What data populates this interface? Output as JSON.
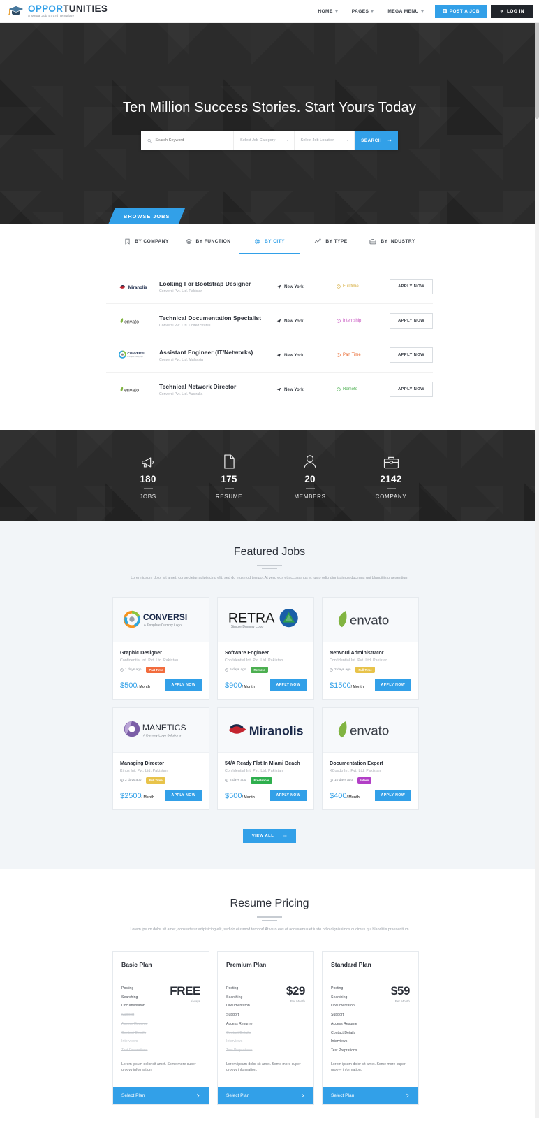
{
  "colors": {
    "accent": "#32a0e8",
    "dark": "#2b2b2b",
    "headerDark": "#21252b"
  },
  "header": {
    "logo": {
      "blue_part": "OPPOR",
      "dark_part": "TUNITIES",
      "tagline": "A Mega Job Board Template",
      "icon": "graduation-cap-icon"
    },
    "nav": [
      {
        "label": "HOME",
        "caret": true
      },
      {
        "label": "PAGES",
        "caret": true
      },
      {
        "label": "MEGA MENU",
        "caret": true
      }
    ],
    "post_job_label": "POST A JOB",
    "login_label": "LOG IN"
  },
  "hero": {
    "title": "Ten Million Success Stories. Start Yours Today",
    "search": {
      "keyword_placeholder": "Search Keyword",
      "category_value": "Select Job Category",
      "location_value": "Select Job Location",
      "button_label": "SEARCH"
    },
    "browse_tab_label": "BROWSE JOBS"
  },
  "tabs": [
    {
      "label": "BY COMPANY",
      "icon": "bookmark-icon",
      "active": false
    },
    {
      "label": "BY FUNCTION",
      "icon": "layers-icon",
      "active": false
    },
    {
      "label": "BY CITY",
      "icon": "globe-icon",
      "active": true
    },
    {
      "label": "BY TYPE",
      "icon": "chart-line-icon",
      "active": false
    },
    {
      "label": "BY INDUSTRY",
      "icon": "briefcase-icon",
      "active": false
    }
  ],
  "jobs": [
    {
      "logo": "miranolis",
      "title": "Looking For Bootstrap Designer",
      "company": "Conversi Pvt. Ltd. Pakistan",
      "location": "New York",
      "type": "Full time",
      "type_color": "#d4a934",
      "apply": "APPLY NOW"
    },
    {
      "logo": "envato",
      "title": "Technical Documentation Specialist",
      "company": "Conversi Pvt. Ltd. United States",
      "location": "New York",
      "type": "Internship",
      "type_color": "#c44bbd",
      "apply": "APPLY NOW"
    },
    {
      "logo": "conversi",
      "title": "Assistant Engineer (IT/Networks)",
      "company": "Conversi Pvt. Ltd. Malaysia",
      "location": "New York",
      "type": "Part Time",
      "type_color": "#e8652a",
      "apply": "APPLY NOW"
    },
    {
      "logo": "envato",
      "title": "Technical Network Director",
      "company": "Conversi Pvt. Ltd. Australia",
      "location": "New York",
      "type": "Remote",
      "type_color": "#4caf50",
      "apply": "APPLY NOW"
    }
  ],
  "counters": [
    {
      "icon": "megaphone-icon",
      "number": "180",
      "label": "JOBS"
    },
    {
      "icon": "document-icon",
      "number": "175",
      "label": "RESUME"
    },
    {
      "icon": "user-icon",
      "number": "20",
      "label": "MEMBERS"
    },
    {
      "icon": "briefcase-icon",
      "number": "2142",
      "label": "COMPANY"
    }
  ],
  "featured": {
    "title": "Featured Jobs",
    "subtitle": "Lorem ipsum dolor sit amet, consectetur adipisicing elit, sed do eiusmod tempor.At vero eos et accusamus et iusto odio dignissimos ducimus qui blanditiis praesentium",
    "view_all_label": "VIEW ALL",
    "cards": [
      {
        "logo": "conversi",
        "logo_text": "CONVERSI",
        "logo_sub": "A Template Dummy Logo",
        "title": "Graphic Designer",
        "company": "Confidential Int. Pvt. Ltd. Pakistan",
        "days": "1 days ago",
        "badge": "Part Time",
        "badge_color": "#f26c3d",
        "price": "$500",
        "per": "/ Month",
        "apply": "APPLY NOW"
      },
      {
        "logo": "retra",
        "logo_text": "RETRA",
        "logo_sub": "Simple Dummy Logo",
        "title": "Software Engineer",
        "company": "Confidential Int. Pvt. Ltd. Pakistan",
        "days": "5 days ago",
        "badge": "Remote",
        "badge_color": "#4caf50",
        "price": "$900",
        "per": "/ Month",
        "apply": "APPLY NOW"
      },
      {
        "logo": "envato",
        "logo_text": "envato",
        "logo_sub": "",
        "title": "Netword Administrator",
        "company": "Confidential Int. Pvt. Ltd. Pakistan",
        "days": "2 days ago",
        "badge": "Full Time",
        "badge_color": "#e8c34a",
        "price": "$1500",
        "per": "/ Month",
        "apply": "APPLY NOW"
      },
      {
        "logo": "manetics",
        "logo_text": "MANETICS",
        "logo_sub": "A Dummy Logo Solutions",
        "title": "Managing Director",
        "company": "Kings Int. Pvt. Ltd. Pakistan",
        "days": "2 days ago",
        "badge": "Full Time",
        "badge_color": "#e8c34a",
        "price": "$2500",
        "per": "/ Month",
        "apply": "APPLY NOW"
      },
      {
        "logo": "miranolis",
        "logo_text": "Miranolis",
        "logo_sub": "",
        "title": "54/A Ready Flat In Miami Beach",
        "company": "Confidential Int. Pvt. Ltd. Pakistan",
        "days": "2 days ago",
        "badge": "Freelancer",
        "badge_color": "#2eaf4d",
        "price": "$500",
        "per": "/ Month",
        "apply": "APPLY NOW"
      },
      {
        "logo": "envato",
        "logo_text": "envato",
        "logo_sub": "",
        "title": "Documentation Expert",
        "company": "XCosdo Int. Pvt. Ltd. Pakistan",
        "days": "10 days ago",
        "badge": "Intern",
        "badge_color": "#b23fc6",
        "price": "$400",
        "per": "/ Month",
        "apply": "APPLY NOW"
      }
    ]
  },
  "pricing": {
    "title": "Resume Pricing",
    "subtitle": "Lorem ipsum dolor sit amet, consectetur adipisicing elit, sed do eiusmod tempor! At vero eos et accusamus et iusto odio.dignissimos.ducimus qui blanditiis praesentium",
    "note": "Lorem ipsum dolor sit amet. Some more super groovy information.",
    "select_label": "Select Plan",
    "plans": [
      {
        "name": "Basic Plan",
        "amount": "FREE",
        "period": "Always",
        "features": [
          {
            "label": "Posting",
            "enabled": true
          },
          {
            "label": "Searching",
            "enabled": true
          },
          {
            "label": "Documentaton",
            "enabled": true
          },
          {
            "label": "Support",
            "enabled": false
          },
          {
            "label": "Access Resume",
            "enabled": false
          },
          {
            "label": "Contact Details",
            "enabled": false
          },
          {
            "label": "Interviews",
            "enabled": false
          },
          {
            "label": "Test Preprations",
            "enabled": false
          }
        ]
      },
      {
        "name": "Premium Plan",
        "amount": "$29",
        "period": "Per Month",
        "features": [
          {
            "label": "Posting",
            "enabled": true
          },
          {
            "label": "Searching",
            "enabled": true
          },
          {
            "label": "Documentaton",
            "enabled": true
          },
          {
            "label": "Support",
            "enabled": true
          },
          {
            "label": "Access Resume",
            "enabled": true
          },
          {
            "label": "Contact Details",
            "enabled": false
          },
          {
            "label": "Interviews",
            "enabled": false
          },
          {
            "label": "Test Preprations",
            "enabled": false
          }
        ]
      },
      {
        "name": "Standard Plan",
        "amount": "$59",
        "period": "Per Month",
        "features": [
          {
            "label": "Posting",
            "enabled": true
          },
          {
            "label": "Searching",
            "enabled": true
          },
          {
            "label": "Documentaton",
            "enabled": true
          },
          {
            "label": "Support",
            "enabled": true
          },
          {
            "label": "Access Resume",
            "enabled": true
          },
          {
            "label": "Contact Details",
            "enabled": true
          },
          {
            "label": "Interviews",
            "enabled": true
          },
          {
            "label": "Test Preprations",
            "enabled": true
          }
        ]
      }
    ]
  }
}
